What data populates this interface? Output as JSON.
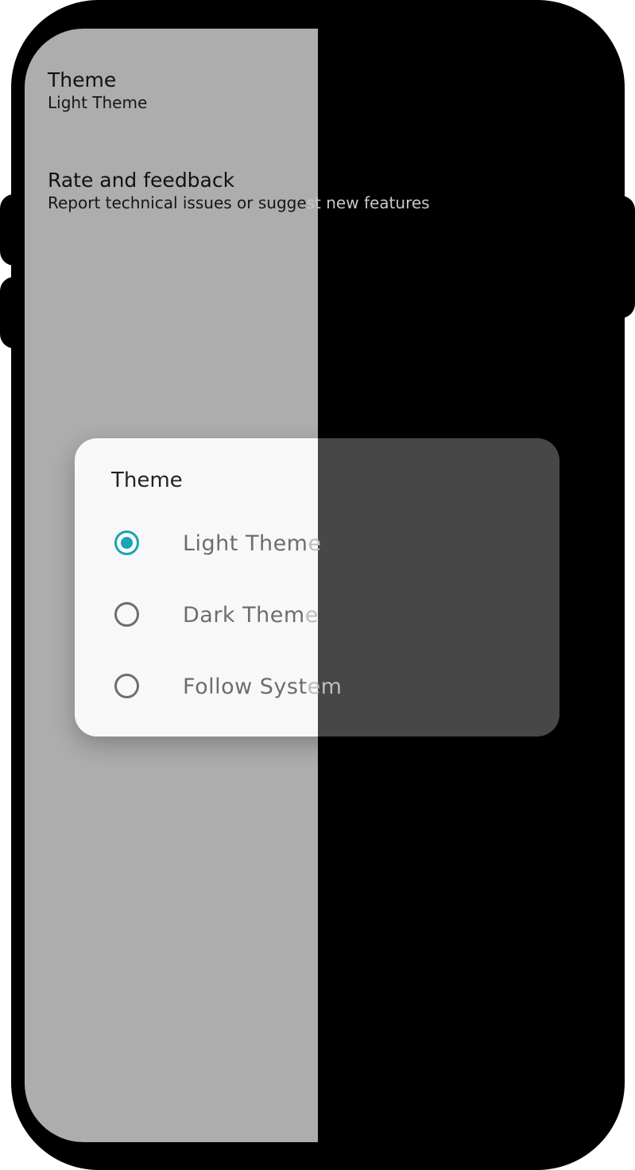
{
  "settings": {
    "theme": {
      "title": "Theme",
      "subtitle": "Light Theme"
    },
    "rate": {
      "title": "Rate and feedback",
      "subtitle_left": "Report technical issues or sugge",
      "subtitle_right": "st new features"
    }
  },
  "dialog": {
    "title": "Theme",
    "options": [
      {
        "label_left": "Light Them",
        "label_right": "e",
        "selected": true
      },
      {
        "label_left": "Dark Them",
        "label_right": "e",
        "selected": false
      },
      {
        "label_left": "Follow Syst",
        "label_right": "em",
        "selected": false
      }
    ]
  },
  "colors": {
    "accent": "#1aa3b8",
    "scrim_light": "#adadad",
    "scrim_dark": "#000000"
  }
}
